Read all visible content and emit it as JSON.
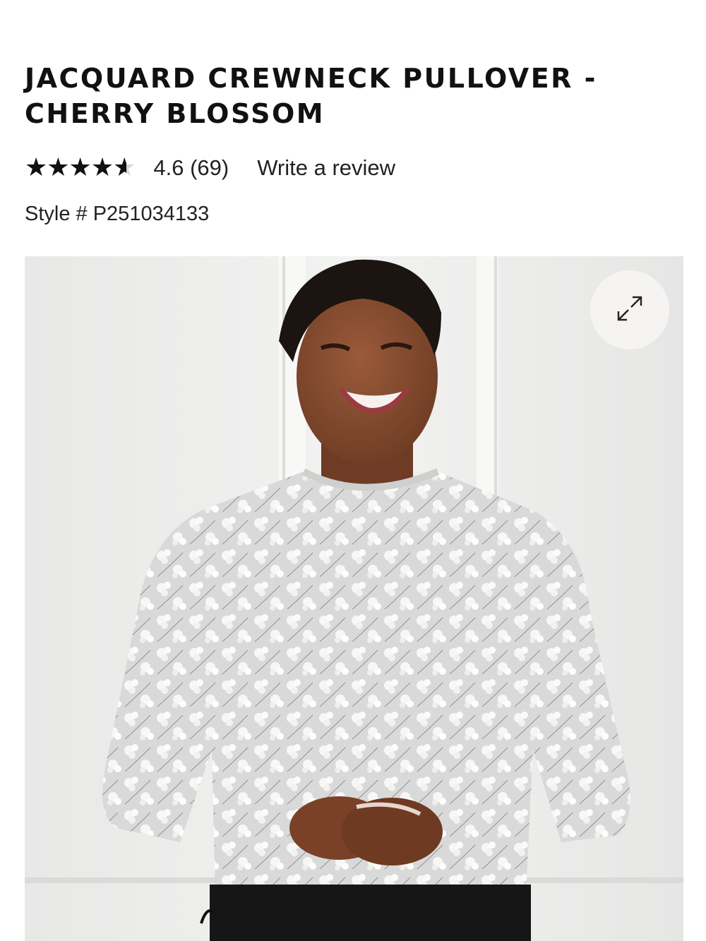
{
  "product": {
    "title": "JACQUARD CREWNECK PULLOVER - CHERRY BLOSSOM",
    "stars": "★★★★★",
    "rating_value": 4.6,
    "rating_text": "4.6 (69)",
    "write_review": "Write a review",
    "style_number": "Style # P251034133"
  },
  "gallery": {
    "expand_icon": "expand-arrows-icon",
    "image_subject": "model-in-sweater-photo"
  },
  "colors": {
    "text": "#111111",
    "star_empty": "#d6d6d6",
    "button_bg": "#f5f4f2"
  }
}
